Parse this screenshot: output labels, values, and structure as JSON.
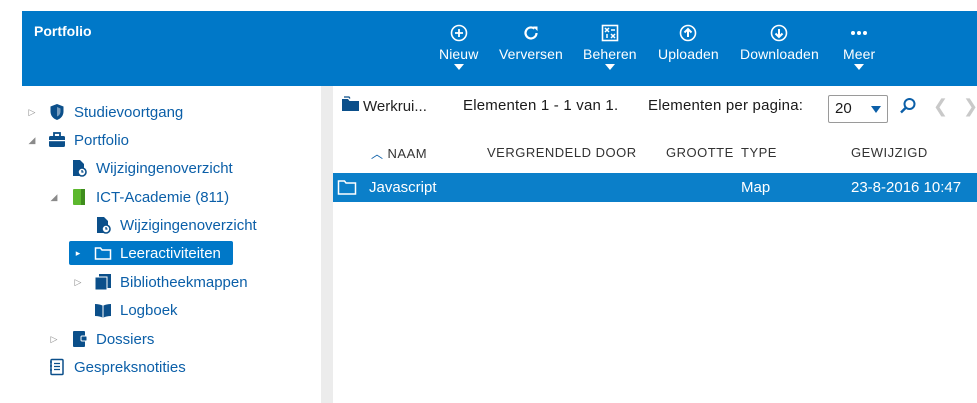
{
  "app": {
    "title": "Portfolio"
  },
  "toolbar": {
    "new_label": "Nieuw",
    "refresh_label": "Verversen",
    "manage_label": "Beheren",
    "upload_label": "Uploaden",
    "download_label": "Downloaden",
    "more_label": "Meer"
  },
  "tree": {
    "items": [
      {
        "label": "Studievoortgang",
        "icon": "shield-icon"
      },
      {
        "label": "Portfolio",
        "icon": "briefcase-icon"
      },
      {
        "label": "Wijzigingenoverzicht",
        "icon": "document-clock-icon"
      },
      {
        "label": "ICT-Academie (811)",
        "icon": "green-notebook-icon"
      },
      {
        "label": "Wijzigingenoverzicht",
        "icon": "document-clock-icon"
      },
      {
        "label": "Leeractiviteiten",
        "icon": "folder-icon"
      },
      {
        "label": "Bibliotheekmappen",
        "icon": "books-icon"
      },
      {
        "label": "Logboek",
        "icon": "open-book-icon"
      },
      {
        "label": "Dossiers",
        "icon": "folder-book-icon"
      },
      {
        "label": "Gespreksnotities",
        "icon": "notes-icon"
      }
    ]
  },
  "main": {
    "work_label": "Werkrui...",
    "paging_text": "Elementen 1 - 1 van 1.",
    "per_page_label": "Elementen per pagina:",
    "per_page_value": "20",
    "columns": [
      "NAAM",
      "VERGRENDELD DOOR",
      "GROOTTE",
      "TYPE",
      "GEWIJZIGD"
    ],
    "rows": [
      {
        "name": "Javascript",
        "locked_by": "",
        "size": "",
        "type": "Map",
        "modified": "23-8-2016 10:47"
      }
    ]
  },
  "colors": {
    "accent": "#0078c8",
    "link": "#0b5fa8",
    "selected": "#0b7fc9"
  }
}
